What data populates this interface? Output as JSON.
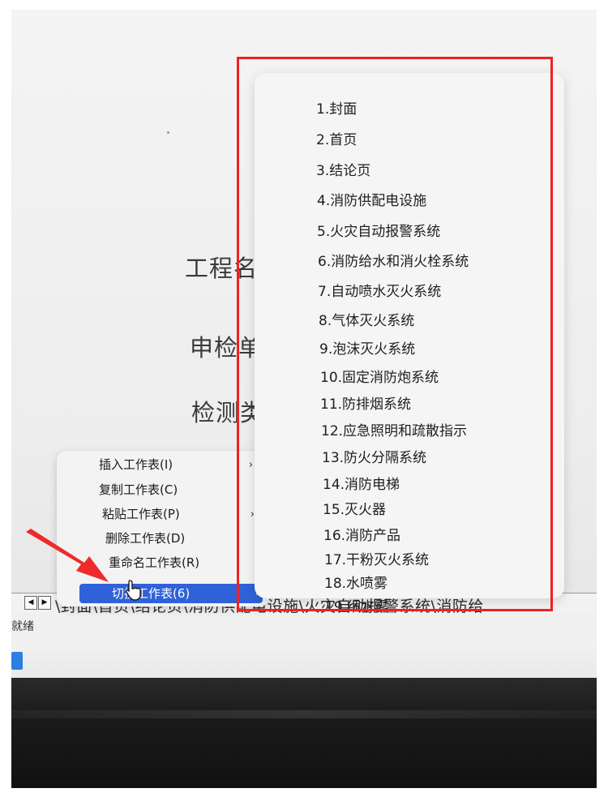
{
  "document": {
    "labels": [
      "工程名",
      "申检单",
      "检测类"
    ]
  },
  "context_menu": {
    "items": [
      {
        "label": "插入工作表(I)",
        "has_submenu": true
      },
      {
        "label": "复制工作表(C)",
        "has_submenu": false
      },
      {
        "label": "粘贴工作表(P)",
        "has_submenu": true
      },
      {
        "label": "删除工作表(D)",
        "has_submenu": false
      },
      {
        "label": "重命名工作表(R)",
        "has_submenu": false
      },
      {
        "label": "切换工作表(6)",
        "has_submenu": true,
        "highlighted": true
      }
    ],
    "arrow_glyph": "›"
  },
  "sheet_menu": {
    "items": [
      "1.封面",
      "2.首页",
      "3.结论页",
      "4.消防供配电设施",
      "5.火灾自动报警系统",
      "6.消防给水和消火栓系统",
      "7.自动喷水灭火系统",
      "8.气体灭火系统",
      "9.泡沫灭火系统",
      "10.固定消防炮系统",
      "11.防排烟系统",
      "12.应急照明和疏散指示",
      "13.防火分隔系统",
      "14.消防电梯",
      "15.灭火器",
      "16.消防产品",
      "17.干粉灭火系统",
      "18.水喷雾",
      "19.细水雾"
    ]
  },
  "tab_bar": {
    "nav_left": "◀",
    "nav_right": "▶",
    "tabs_text": "\\封面\\首页\\结论页\\消防供配电设施\\火灾自动报警系统\\消防给"
  },
  "status_bar": {
    "text": "就绪"
  },
  "colors": {
    "highlight": "#2f62d8",
    "annotation_red": "#ee2222",
    "taskbar_icon": "#2a7fe0"
  }
}
